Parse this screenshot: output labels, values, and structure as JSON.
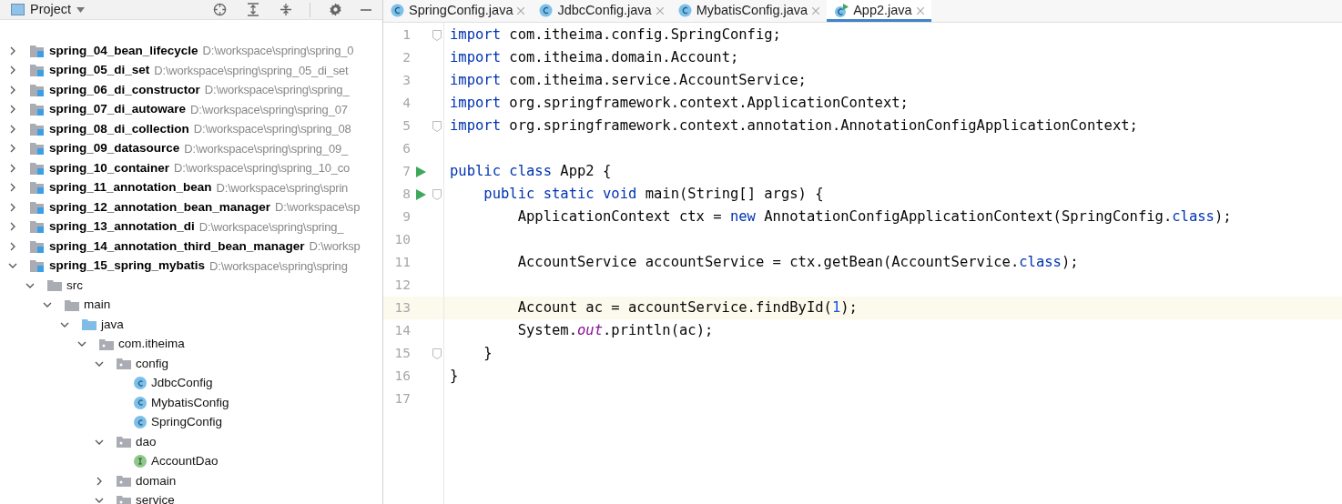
{
  "project_panel": {
    "title": "Project",
    "tree": [
      {
        "name": "spring_04_bean_lifecycle",
        "path": "D:\\workspace\\spring\\spring_0",
        "kind": "module",
        "expanded": false
      },
      {
        "name": "spring_05_di_set",
        "path": "D:\\workspace\\spring\\spring_05_di_set",
        "kind": "module",
        "expanded": false
      },
      {
        "name": "spring_06_di_constructor",
        "path": "D:\\workspace\\spring\\spring_",
        "kind": "module",
        "expanded": false
      },
      {
        "name": "spring_07_di_autoware",
        "path": "D:\\workspace\\spring\\spring_07",
        "kind": "module",
        "expanded": false
      },
      {
        "name": "spring_08_di_collection",
        "path": "D:\\workspace\\spring\\spring_08",
        "kind": "module",
        "expanded": false
      },
      {
        "name": "spring_09_datasource",
        "path": "D:\\workspace\\spring\\spring_09_",
        "kind": "module",
        "expanded": false
      },
      {
        "name": "spring_10_container",
        "path": "D:\\workspace\\spring\\spring_10_co",
        "kind": "module",
        "expanded": false
      },
      {
        "name": "spring_11_annotation_bean",
        "path": "D:\\workspace\\spring\\sprin",
        "kind": "module",
        "expanded": false
      },
      {
        "name": "spring_12_annotation_bean_manager",
        "path": "D:\\workspace\\sp",
        "kind": "module",
        "expanded": false
      },
      {
        "name": "spring_13_annotation_di",
        "path": "D:\\workspace\\spring\\spring_",
        "kind": "module",
        "expanded": false
      },
      {
        "name": "spring_14_annotation_third_bean_manager",
        "path": "D:\\worksp",
        "kind": "module",
        "expanded": false
      },
      {
        "name": "spring_15_spring_mybatis",
        "path": "D:\\workspace\\spring\\spring",
        "kind": "module",
        "expanded": true,
        "children": [
          {
            "name": "src",
            "kind": "folder",
            "expanded": true,
            "children": [
              {
                "name": "main",
                "kind": "folder",
                "expanded": true,
                "children": [
                  {
                    "name": "java",
                    "kind": "source",
                    "expanded": true,
                    "children": [
                      {
                        "name": "com.itheima",
                        "kind": "package",
                        "expanded": true,
                        "children": [
                          {
                            "name": "config",
                            "kind": "package",
                            "expanded": true,
                            "children": [
                              {
                                "name": "JdbcConfig",
                                "kind": "class"
                              },
                              {
                                "name": "MybatisConfig",
                                "kind": "class"
                              },
                              {
                                "name": "SpringConfig",
                                "kind": "class"
                              }
                            ]
                          },
                          {
                            "name": "dao",
                            "kind": "package",
                            "expanded": true,
                            "children": [
                              {
                                "name": "AccountDao",
                                "kind": "interface"
                              }
                            ]
                          },
                          {
                            "name": "domain",
                            "kind": "package",
                            "expanded": false
                          },
                          {
                            "name": "service",
                            "kind": "package",
                            "expanded": true
                          }
                        ]
                      }
                    ]
                  }
                ]
              }
            ]
          }
        ]
      }
    ]
  },
  "tabs": [
    {
      "label": "SpringConfig.java",
      "kind": "class",
      "selected": false
    },
    {
      "label": "JdbcConfig.java",
      "kind": "class",
      "selected": false
    },
    {
      "label": "MybatisConfig.java",
      "kind": "class",
      "selected": false
    },
    {
      "label": "App2.java",
      "kind": "runnable",
      "selected": true
    }
  ],
  "editor": {
    "lines": [
      {
        "number": "1",
        "fold": true,
        "tokens": [
          {
            "text": "import",
            "kind": "keyword"
          },
          {
            "text": " com.itheima.config.SpringConfig;",
            "kind": "plain"
          }
        ]
      },
      {
        "number": "2",
        "tokens": [
          {
            "text": "import",
            "kind": "keyword"
          },
          {
            "text": " com.itheima.domain.Account;",
            "kind": "plain"
          }
        ]
      },
      {
        "number": "3",
        "tokens": [
          {
            "text": "import",
            "kind": "keyword"
          },
          {
            "text": " com.itheima.service.AccountService;",
            "kind": "plain"
          }
        ]
      },
      {
        "number": "4",
        "tokens": [
          {
            "text": "import",
            "kind": "keyword"
          },
          {
            "text": " org.springframework.context.ApplicationContext;",
            "kind": "plain"
          }
        ]
      },
      {
        "number": "5",
        "fold": true,
        "tokens": [
          {
            "text": "import",
            "kind": "keyword"
          },
          {
            "text": " org.springframework.context.annotation.AnnotationConfigApplicationContext;",
            "kind": "plain"
          }
        ]
      },
      {
        "number": "6"
      },
      {
        "number": "7",
        "run": true,
        "tokens": [
          {
            "text": "public class",
            "kind": "keyword"
          },
          {
            "text": " App2 {",
            "kind": "plain"
          }
        ]
      },
      {
        "number": "8",
        "run": true,
        "fold": true,
        "tokens": [
          {
            "text": "    public static void",
            "kind": "keyword"
          },
          {
            "text": " main(String[] args) {",
            "kind": "plain"
          }
        ]
      },
      {
        "number": "9",
        "tokens": [
          {
            "text": "        ApplicationContext ctx = ",
            "kind": "plain"
          },
          {
            "text": "new",
            "kind": "keyword"
          },
          {
            "text": " AnnotationConfigApplicationContext(SpringConfig.",
            "kind": "plain"
          },
          {
            "text": "class",
            "kind": "keyword"
          },
          {
            "text": ");",
            "kind": "plain"
          }
        ]
      },
      {
        "number": "10"
      },
      {
        "number": "11",
        "tokens": [
          {
            "text": "        AccountService accountService = ctx.getBean(AccountService.",
            "kind": "plain"
          },
          {
            "text": "class",
            "kind": "keyword"
          },
          {
            "text": ");",
            "kind": "plain"
          }
        ]
      },
      {
        "number": "12"
      },
      {
        "number": "13",
        "current": true,
        "tokens": [
          {
            "text": "        Account ac = accountService.findById(",
            "kind": "plain"
          },
          {
            "text": "1",
            "kind": "number"
          },
          {
            "text": ");",
            "kind": "plain"
          }
        ]
      },
      {
        "number": "14",
        "tokens": [
          {
            "text": "        System.",
            "kind": "plain"
          },
          {
            "text": "out",
            "kind": "field"
          },
          {
            "text": ".println(ac);",
            "kind": "plain"
          }
        ]
      },
      {
        "number": "15",
        "fold": true,
        "tokens": [
          {
            "text": "    }",
            "kind": "plain"
          }
        ]
      },
      {
        "number": "16",
        "tokens": [
          {
            "text": "}",
            "kind": "plain"
          }
        ]
      },
      {
        "number": "17"
      }
    ]
  }
}
